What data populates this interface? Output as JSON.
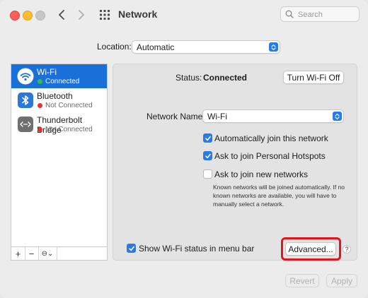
{
  "window": {
    "title": "Network"
  },
  "search": {
    "placeholder": "Search"
  },
  "location": {
    "label": "Location:",
    "value": "Automatic"
  },
  "sidebar": {
    "items": [
      {
        "name": "Wi-Fi",
        "status": "Connected",
        "status_color": "#30c048",
        "icon": "wifi-icon",
        "selected": true
      },
      {
        "name": "Bluetooth",
        "status": "Not Connected",
        "status_color": "#e0352e",
        "icon": "bluetooth-icon",
        "selected": false
      },
      {
        "name": "Thunderbolt Bridge",
        "status": "Not Connected",
        "status_color": "#e0352e",
        "icon": "thunderbolt-bridge-icon",
        "selected": false
      }
    ],
    "tools": {
      "add": "+",
      "remove": "−",
      "action": "⊖⌄"
    }
  },
  "panel": {
    "status_label": "Status:",
    "status_value": "Connected",
    "turn_off_label": "Turn Wi-Fi Off",
    "network_name_label": "Network Name:",
    "network_name_value": "Wi-Fi",
    "checkboxes": [
      {
        "label": "Automatically join this network",
        "checked": true
      },
      {
        "label": "Ask to join Personal Hotspots",
        "checked": true
      },
      {
        "label": "Ask to join new networks",
        "checked": false
      }
    ],
    "note": "Known networks will be joined automatically. If no known networks are available, you will have to manually select a network.",
    "show_status": {
      "label": "Show Wi-Fi status in menu bar",
      "checked": true
    },
    "advanced_label": "Advanced...",
    "help_label": "?"
  },
  "footer": {
    "revert_label": "Revert",
    "apply_label": "Apply"
  },
  "colors": {
    "accent": "#2a7ae4",
    "selection": "#1b6fd9",
    "highlight": "#e0161c"
  }
}
